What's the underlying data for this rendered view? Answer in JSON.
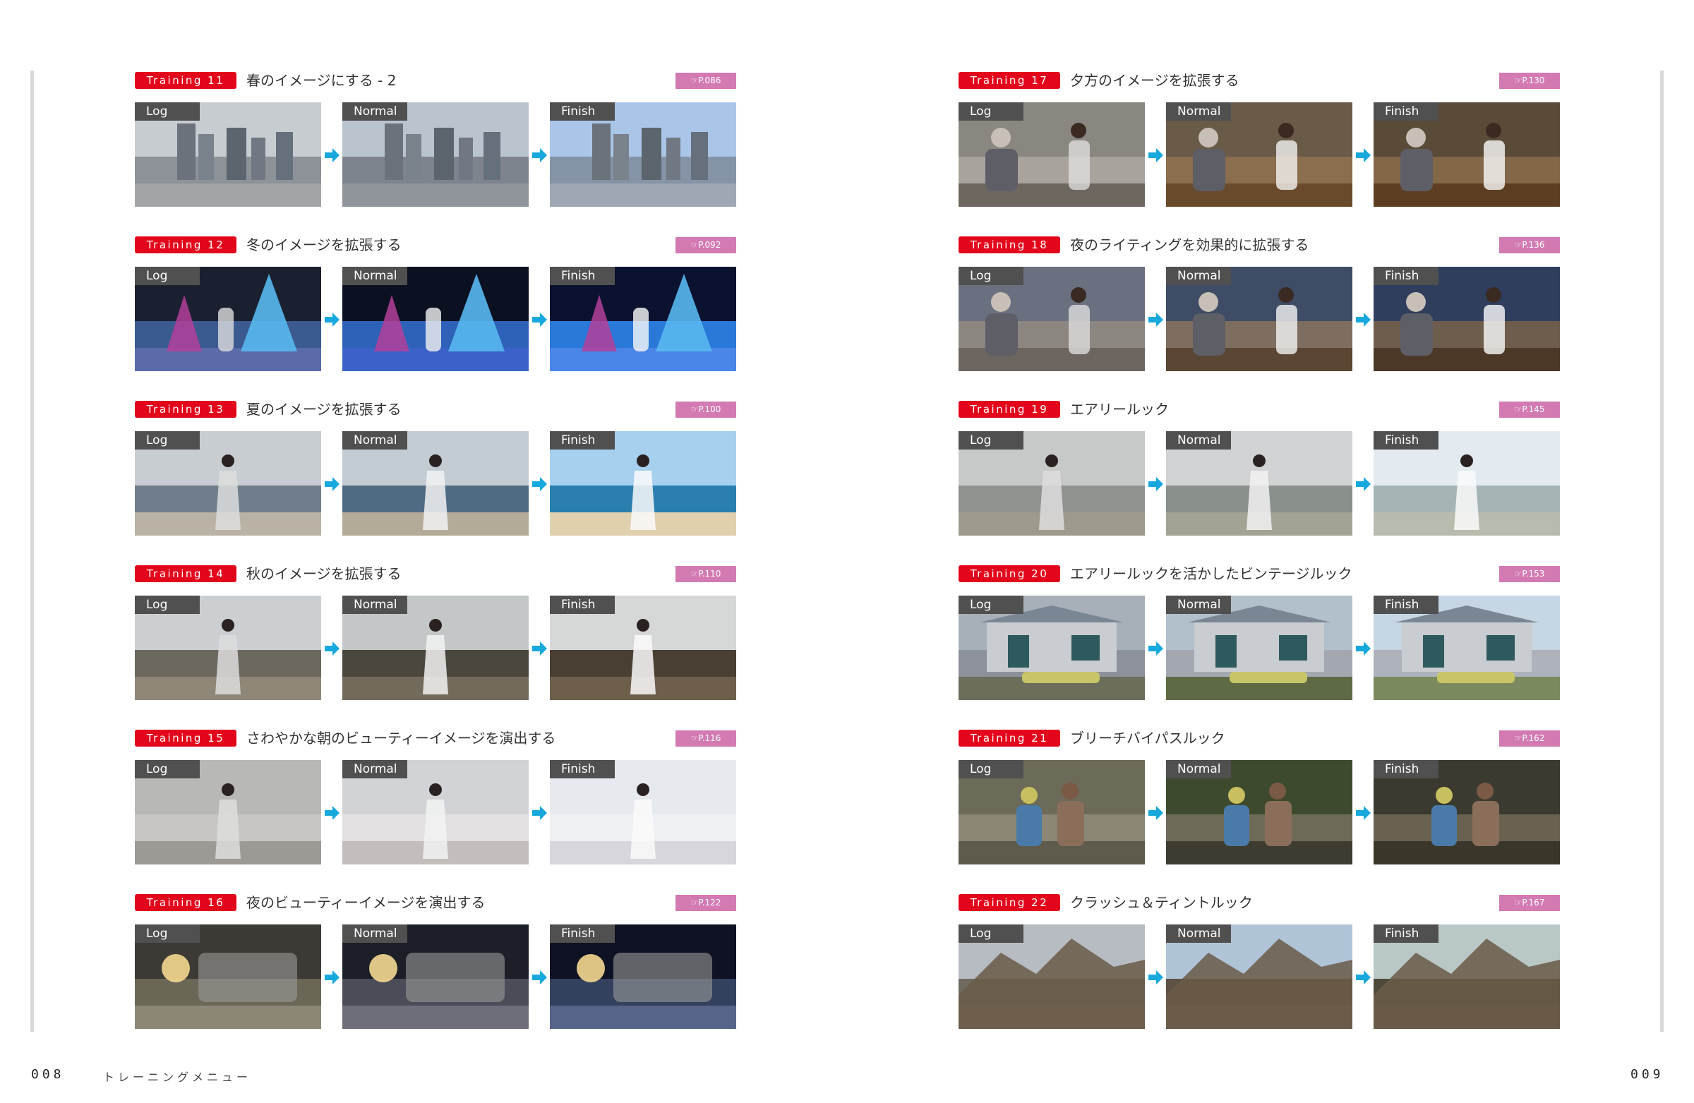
{
  "page_left": {
    "folio": "008",
    "running_head": "トレーニングメニュー"
  },
  "page_right": {
    "folio": "009"
  },
  "stage_labels": [
    "Log",
    "Normal",
    "Finish"
  ],
  "colors": {
    "badge_red": "#e3051b",
    "ref_pink": "#d37ab3",
    "arrow_blue": "#17a8dd",
    "label_gray": "#505050"
  },
  "ref_icon": "pointing-hand-icon",
  "left_column": [
    {
      "badge": "Training 11",
      "title": "春のイメージにする - 2",
      "ref": "☞P.086",
      "scene": "city"
    },
    {
      "badge": "Training 12",
      "title": "冬のイメージを拡張する",
      "ref": "☞P.092",
      "scene": "lights"
    },
    {
      "badge": "Training 13",
      "title": "夏のイメージを拡張する",
      "ref": "☞P.100",
      "scene": "beach"
    },
    {
      "badge": "Training 14",
      "title": "秋のイメージを拡張する",
      "ref": "☞P.110",
      "scene": "autumn"
    },
    {
      "badge": "Training 15",
      "title": "さわやかな朝のビューティーイメージを演出する",
      "ref": "☞P.116",
      "scene": "morning"
    },
    {
      "badge": "Training 16",
      "title": "夜のビューティーイメージを演出する",
      "ref": "☞P.122",
      "scene": "night"
    }
  ],
  "right_column": [
    {
      "badge": "Training 17",
      "title": "夕方のイメージを拡張する",
      "ref": "☞P.130",
      "scene": "kitchen"
    },
    {
      "badge": "Training 18",
      "title": "夜のライティングを効果的に拡張する",
      "ref": "☞P.136",
      "scene": "dinner"
    },
    {
      "badge": "Training 19",
      "title": "エアリールック",
      "ref": "☞P.145",
      "scene": "airy"
    },
    {
      "badge": "Training 20",
      "title": "エアリールックを活かしたビンテージルック",
      "ref": "☞P.153",
      "scene": "house"
    },
    {
      "badge": "Training 21",
      "title": "ブリーチバイパスルック",
      "ref": "☞P.162",
      "scene": "men"
    },
    {
      "badge": "Training 22",
      "title": "クラッシュ＆ティントルック",
      "ref": "☞P.167",
      "scene": "mountain"
    }
  ]
}
